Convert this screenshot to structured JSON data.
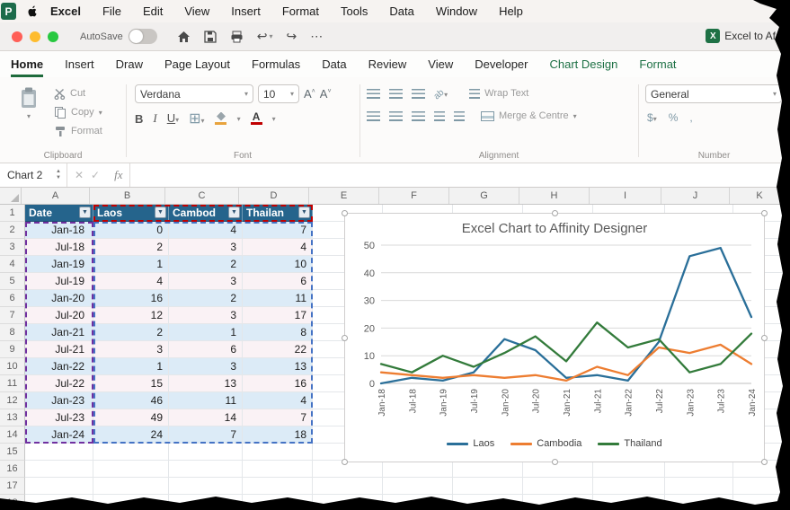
{
  "menubar": {
    "app_name": "Excel",
    "items": [
      "File",
      "Edit",
      "View",
      "Insert",
      "Format",
      "Tools",
      "Data",
      "Window",
      "Help"
    ]
  },
  "titlebar": {
    "autosave_label": "AutoSave",
    "doc_title": "Excel to Af"
  },
  "ribbon": {
    "tabs": [
      {
        "label": "Home",
        "state": "active",
        "color": "default"
      },
      {
        "label": "Insert"
      },
      {
        "label": "Draw"
      },
      {
        "label": "Page Layout"
      },
      {
        "label": "Formulas"
      },
      {
        "label": "Data"
      },
      {
        "label": "Review"
      },
      {
        "label": "View"
      },
      {
        "label": "Developer"
      },
      {
        "label": "Chart Design",
        "color": "green"
      },
      {
        "label": "Format",
        "color": "green"
      }
    ],
    "clipboard": {
      "group_label": "Clipboard",
      "cut_label": "Cut",
      "copy_label": "Copy",
      "format_label": "Format"
    },
    "font": {
      "group_label": "Font",
      "family": "Verdana",
      "size": "10",
      "bold": "B",
      "italic": "I",
      "underline": "U"
    },
    "alignment": {
      "group_label": "Alignment",
      "wrap_label": "Wrap Text",
      "merge_label": "Merge & Centre",
      "orient_label": "ab"
    },
    "number": {
      "group_label": "Number",
      "format": "General",
      "currency": "$",
      "percent": "%",
      "comma": ","
    }
  },
  "formula_bar": {
    "name_box": "Chart 2",
    "fx_label": "fx"
  },
  "grid": {
    "column_headers": [
      "A",
      "B",
      "C",
      "D",
      "E",
      "F",
      "G",
      "H",
      "I",
      "J",
      "K"
    ],
    "row_count": 18,
    "table": {
      "headers": [
        "Date",
        "Laos",
        "Cambod",
        "Thailan"
      ],
      "rows": [
        [
          "Jan-18",
          0,
          4,
          7
        ],
        [
          "Jul-18",
          2,
          3,
          4
        ],
        [
          "Jan-19",
          1,
          2,
          10
        ],
        [
          "Jul-19",
          4,
          3,
          6
        ],
        [
          "Jan-20",
          16,
          2,
          11
        ],
        [
          "Jul-20",
          12,
          3,
          17
        ],
        [
          "Jan-21",
          2,
          1,
          8
        ],
        [
          "Jul-21",
          3,
          6,
          22
        ],
        [
          "Jan-22",
          1,
          3,
          13
        ],
        [
          "Jul-22",
          15,
          13,
          16
        ],
        [
          "Jan-23",
          46,
          11,
          4
        ],
        [
          "Jul-23",
          49,
          14,
          7
        ],
        [
          "Jan-24",
          24,
          7,
          18
        ]
      ]
    }
  },
  "chart_data": {
    "type": "line",
    "title": "Excel Chart to Affinity Designer",
    "x": [
      "Jan-18",
      "Jul-18",
      "Jan-19",
      "Jul-19",
      "Jan-20",
      "Jul-20",
      "Jan-21",
      "Jul-21",
      "Jan-22",
      "Jul-22",
      "Jan-23",
      "Jul-23",
      "Jan-24"
    ],
    "series": [
      {
        "name": "Laos",
        "color": "#2a6f99",
        "values": [
          0,
          2,
          1,
          4,
          16,
          12,
          2,
          3,
          1,
          15,
          46,
          49,
          24
        ]
      },
      {
        "name": "Cambodia",
        "color": "#ed7d31",
        "values": [
          4,
          3,
          2,
          3,
          2,
          3,
          1,
          6,
          3,
          13,
          11,
          14,
          7
        ]
      },
      {
        "name": "Thailand",
        "color": "#337b3b",
        "values": [
          7,
          4,
          10,
          6,
          11,
          17,
          8,
          22,
          13,
          16,
          4,
          7,
          18
        ]
      }
    ],
    "ylim": [
      0,
      50
    ],
    "yticks": [
      0,
      10,
      20,
      30,
      40,
      50
    ],
    "grid": true,
    "legend_position": "bottom"
  },
  "colors": {
    "accent_green": "#1e7145",
    "table_header_bg": "#25648c",
    "band_blue": "#dcebf7",
    "band_pink": "#faf2f5",
    "range_red": "#c00000",
    "range_purple": "#7030a0",
    "range_blue": "#4472c4"
  }
}
